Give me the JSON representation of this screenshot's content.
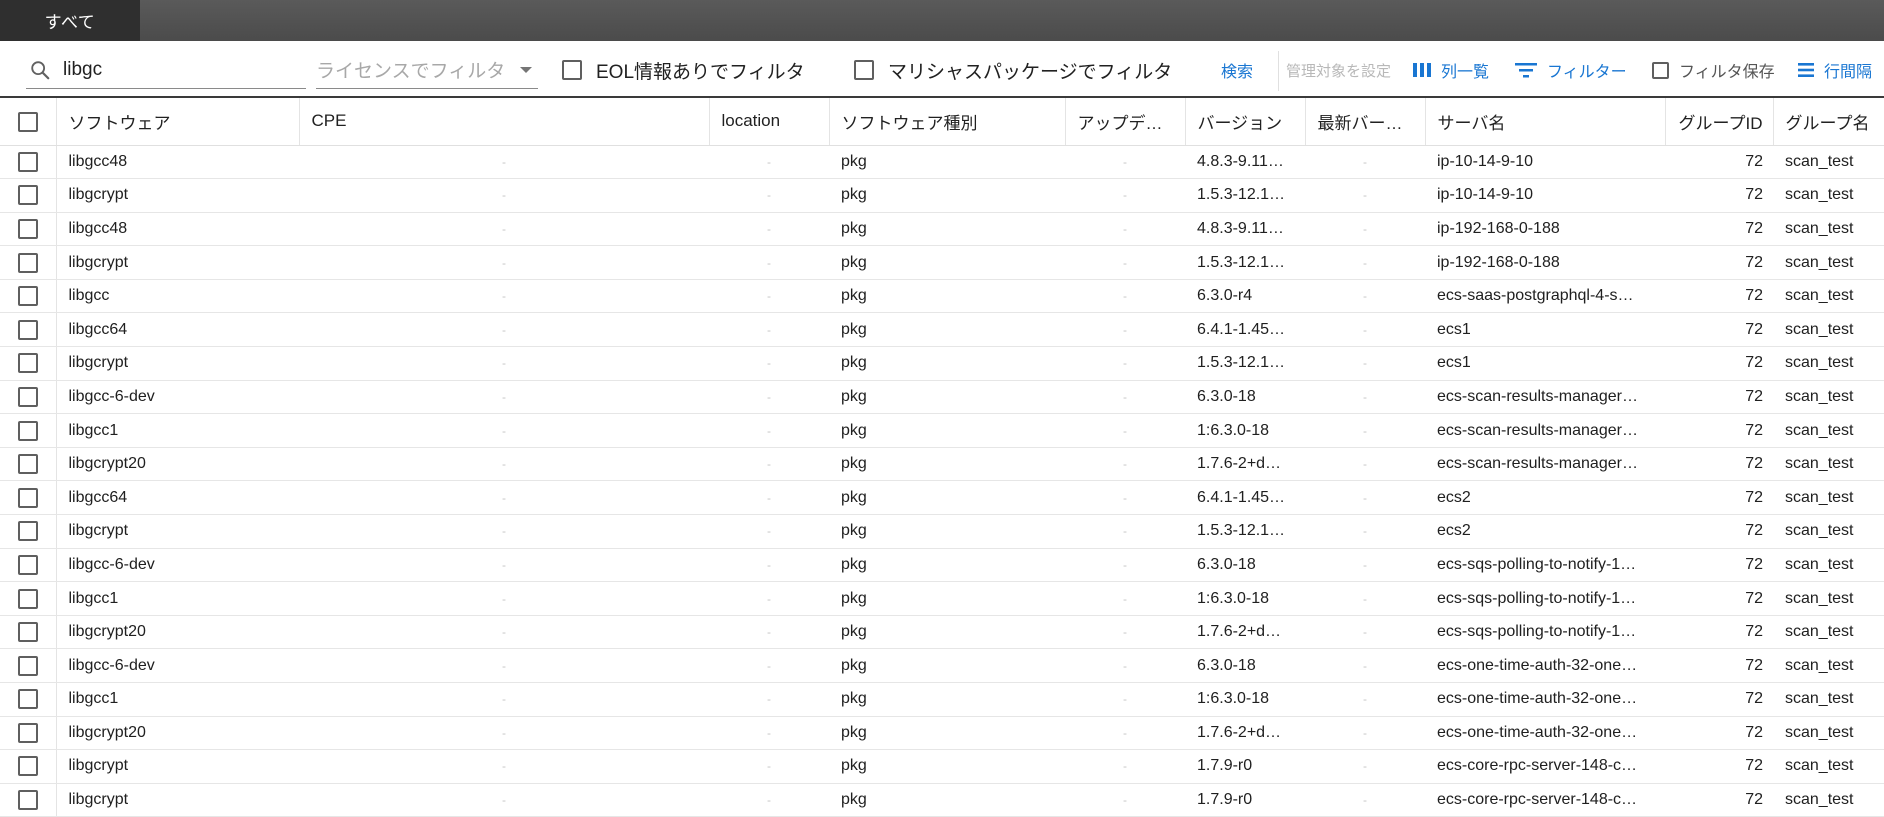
{
  "tabs": [
    {
      "label": "すべて"
    }
  ],
  "toolbar": {
    "search_value": "libgc",
    "license_placeholder": "ライセンスでフィルタ",
    "eol_filter_label": "EOL情報ありでフィルタ",
    "malicious_filter_label": "マリシャスパッケージでフィルタ",
    "search_button": "検索",
    "manage_target_label": "管理対象を設定",
    "columns_label": "列一覧",
    "filter_label": "フィルター",
    "save_filter_label": "フィルタ保存",
    "row_spacing_label": "行間隔"
  },
  "table": {
    "headers": [
      "ソフトウェア",
      "CPE",
      "location",
      "ソフトウェア種別",
      "アップデ…",
      "バージョン",
      "最新バー…",
      "サーバ名",
      "グループID",
      "グループ名"
    ],
    "rows": [
      {
        "software": "libgcc48",
        "cpe": "-",
        "location": "-",
        "type": "pkg",
        "update": "-",
        "version": "4.8.3-9.11…",
        "latest": "-",
        "server": "ip-10-14-9-10",
        "group_id": "72",
        "group_name": "scan_test"
      },
      {
        "software": "libgcrypt",
        "cpe": "-",
        "location": "-",
        "type": "pkg",
        "update": "-",
        "version": "1.5.3-12.1…",
        "latest": "-",
        "server": "ip-10-14-9-10",
        "group_id": "72",
        "group_name": "scan_test"
      },
      {
        "software": "libgcc48",
        "cpe": "-",
        "location": "-",
        "type": "pkg",
        "update": "-",
        "version": "4.8.3-9.11…",
        "latest": "-",
        "server": "ip-192-168-0-188",
        "group_id": "72",
        "group_name": "scan_test"
      },
      {
        "software": "libgcrypt",
        "cpe": "-",
        "location": "-",
        "type": "pkg",
        "update": "-",
        "version": "1.5.3-12.1…",
        "latest": "-",
        "server": "ip-192-168-0-188",
        "group_id": "72",
        "group_name": "scan_test"
      },
      {
        "software": "libgcc",
        "cpe": "-",
        "location": "-",
        "type": "pkg",
        "update": "-",
        "version": "6.3.0-r4",
        "latest": "-",
        "server": "ecs-saas-postgraphql-4-s…",
        "group_id": "72",
        "group_name": "scan_test"
      },
      {
        "software": "libgcc64",
        "cpe": "-",
        "location": "-",
        "type": "pkg",
        "update": "-",
        "version": "6.4.1-1.45…",
        "latest": "-",
        "server": "ecs1",
        "group_id": "72",
        "group_name": "scan_test"
      },
      {
        "software": "libgcrypt",
        "cpe": "-",
        "location": "-",
        "type": "pkg",
        "update": "-",
        "version": "1.5.3-12.1…",
        "latest": "-",
        "server": "ecs1",
        "group_id": "72",
        "group_name": "scan_test"
      },
      {
        "software": "libgcc-6-dev",
        "cpe": "-",
        "location": "-",
        "type": "pkg",
        "update": "-",
        "version": "6.3.0-18",
        "latest": "-",
        "server": "ecs-scan-results-manager…",
        "group_id": "72",
        "group_name": "scan_test"
      },
      {
        "software": "libgcc1",
        "cpe": "-",
        "location": "-",
        "type": "pkg",
        "update": "-",
        "version": "1:6.3.0-18",
        "latest": "-",
        "server": "ecs-scan-results-manager…",
        "group_id": "72",
        "group_name": "scan_test"
      },
      {
        "software": "libgcrypt20",
        "cpe": "-",
        "location": "-",
        "type": "pkg",
        "update": "-",
        "version": "1.7.6-2+d…",
        "latest": "-",
        "server": "ecs-scan-results-manager…",
        "group_id": "72",
        "group_name": "scan_test"
      },
      {
        "software": "libgcc64",
        "cpe": "-",
        "location": "-",
        "type": "pkg",
        "update": "-",
        "version": "6.4.1-1.45…",
        "latest": "-",
        "server": "ecs2",
        "group_id": "72",
        "group_name": "scan_test"
      },
      {
        "software": "libgcrypt",
        "cpe": "-",
        "location": "-",
        "type": "pkg",
        "update": "-",
        "version": "1.5.3-12.1…",
        "latest": "-",
        "server": "ecs2",
        "group_id": "72",
        "group_name": "scan_test"
      },
      {
        "software": "libgcc-6-dev",
        "cpe": "-",
        "location": "-",
        "type": "pkg",
        "update": "-",
        "version": "6.3.0-18",
        "latest": "-",
        "server": "ecs-sqs-polling-to-notify-1…",
        "group_id": "72",
        "group_name": "scan_test"
      },
      {
        "software": "libgcc1",
        "cpe": "-",
        "location": "-",
        "type": "pkg",
        "update": "-",
        "version": "1:6.3.0-18",
        "latest": "-",
        "server": "ecs-sqs-polling-to-notify-1…",
        "group_id": "72",
        "group_name": "scan_test"
      },
      {
        "software": "libgcrypt20",
        "cpe": "-",
        "location": "-",
        "type": "pkg",
        "update": "-",
        "version": "1.7.6-2+d…",
        "latest": "-",
        "server": "ecs-sqs-polling-to-notify-1…",
        "group_id": "72",
        "group_name": "scan_test"
      },
      {
        "software": "libgcc-6-dev",
        "cpe": "-",
        "location": "-",
        "type": "pkg",
        "update": "-",
        "version": "6.3.0-18",
        "latest": "-",
        "server": "ecs-one-time-auth-32-one…",
        "group_id": "72",
        "group_name": "scan_test"
      },
      {
        "software": "libgcc1",
        "cpe": "-",
        "location": "-",
        "type": "pkg",
        "update": "-",
        "version": "1:6.3.0-18",
        "latest": "-",
        "server": "ecs-one-time-auth-32-one…",
        "group_id": "72",
        "group_name": "scan_test"
      },
      {
        "software": "libgcrypt20",
        "cpe": "-",
        "location": "-",
        "type": "pkg",
        "update": "-",
        "version": "1.7.6-2+d…",
        "latest": "-",
        "server": "ecs-one-time-auth-32-one…",
        "group_id": "72",
        "group_name": "scan_test"
      },
      {
        "software": "libgcrypt",
        "cpe": "-",
        "location": "-",
        "type": "pkg",
        "update": "-",
        "version": "1.7.9-r0",
        "latest": "-",
        "server": "ecs-core-rpc-server-148-c…",
        "group_id": "72",
        "group_name": "scan_test"
      },
      {
        "software": "libgcrypt",
        "cpe": "-",
        "location": "-",
        "type": "pkg",
        "update": "-",
        "version": "1.7.9-r0",
        "latest": "-",
        "server": "ecs-core-rpc-server-148-c…",
        "group_id": "72",
        "group_name": "scan_test"
      }
    ]
  },
  "colors": {
    "accent": "#1976d2",
    "tabbar": "#4f4f4f",
    "active_tab": "#2f2f2f"
  },
  "icons": [
    "search-icon",
    "caret-down-icon",
    "columns-icon",
    "filter-icon",
    "density-icon"
  ]
}
